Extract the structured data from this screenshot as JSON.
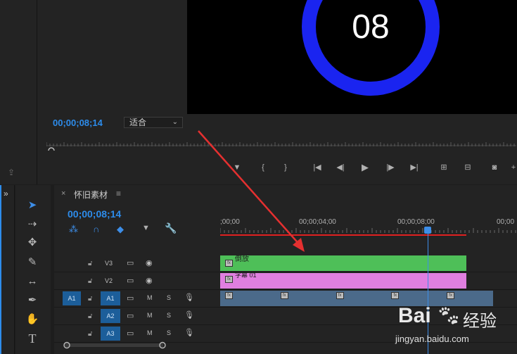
{
  "program_monitor": {
    "video_text": "08",
    "timecode": "00;00;08;14",
    "zoom_value": "适合",
    "accent_ring_color": "#1a24f0"
  },
  "monitor_toolbar": {
    "icons": [
      "marker-icon",
      "in-point-icon",
      "out-point-icon",
      "go-to-in-icon",
      "step-back-icon",
      "play-icon",
      "step-forward-icon",
      "go-to-out-icon",
      "lift-icon",
      "extract-icon",
      "export-frame-icon",
      "more-icon"
    ]
  },
  "timeline": {
    "tab_close": "×",
    "sequence_name": "怀旧素材",
    "tab_menu": "≡",
    "timecode": "00;00;08;14",
    "ruler_labels": [
      ";00;00",
      "00;00;04;00",
      "00;00;08;00",
      "00;00"
    ],
    "tracks": [
      {
        "name": "V3",
        "kind": "video"
      },
      {
        "name": "V2",
        "kind": "video"
      },
      {
        "name": "A1",
        "kind": "audio",
        "source": "A1",
        "mute": "M",
        "solo": "S"
      },
      {
        "name": "A2",
        "kind": "audio",
        "mute": "M",
        "solo": "S"
      },
      {
        "name": "A3",
        "kind": "audio",
        "mute": "M",
        "solo": "S"
      }
    ],
    "clips": {
      "v3_label": "倒放",
      "v2_label": "字幕 01",
      "v3_color": "#4ebf58",
      "v2_color": "#e07fe0",
      "a1_color": "#4b6a8a"
    }
  },
  "tools": [
    "selection-tool-icon",
    "track-select-tool-icon",
    "ripple-edit-tool-icon",
    "razor-tool-icon",
    "slip-tool-icon",
    "pen-tool-icon",
    "hand-tool-icon",
    "type-tool-icon"
  ],
  "watermark": {
    "brand": "Bai",
    "brand_cn": "经验",
    "url": "jingyan.baidu.com"
  },
  "annotation_color": "#e53030"
}
